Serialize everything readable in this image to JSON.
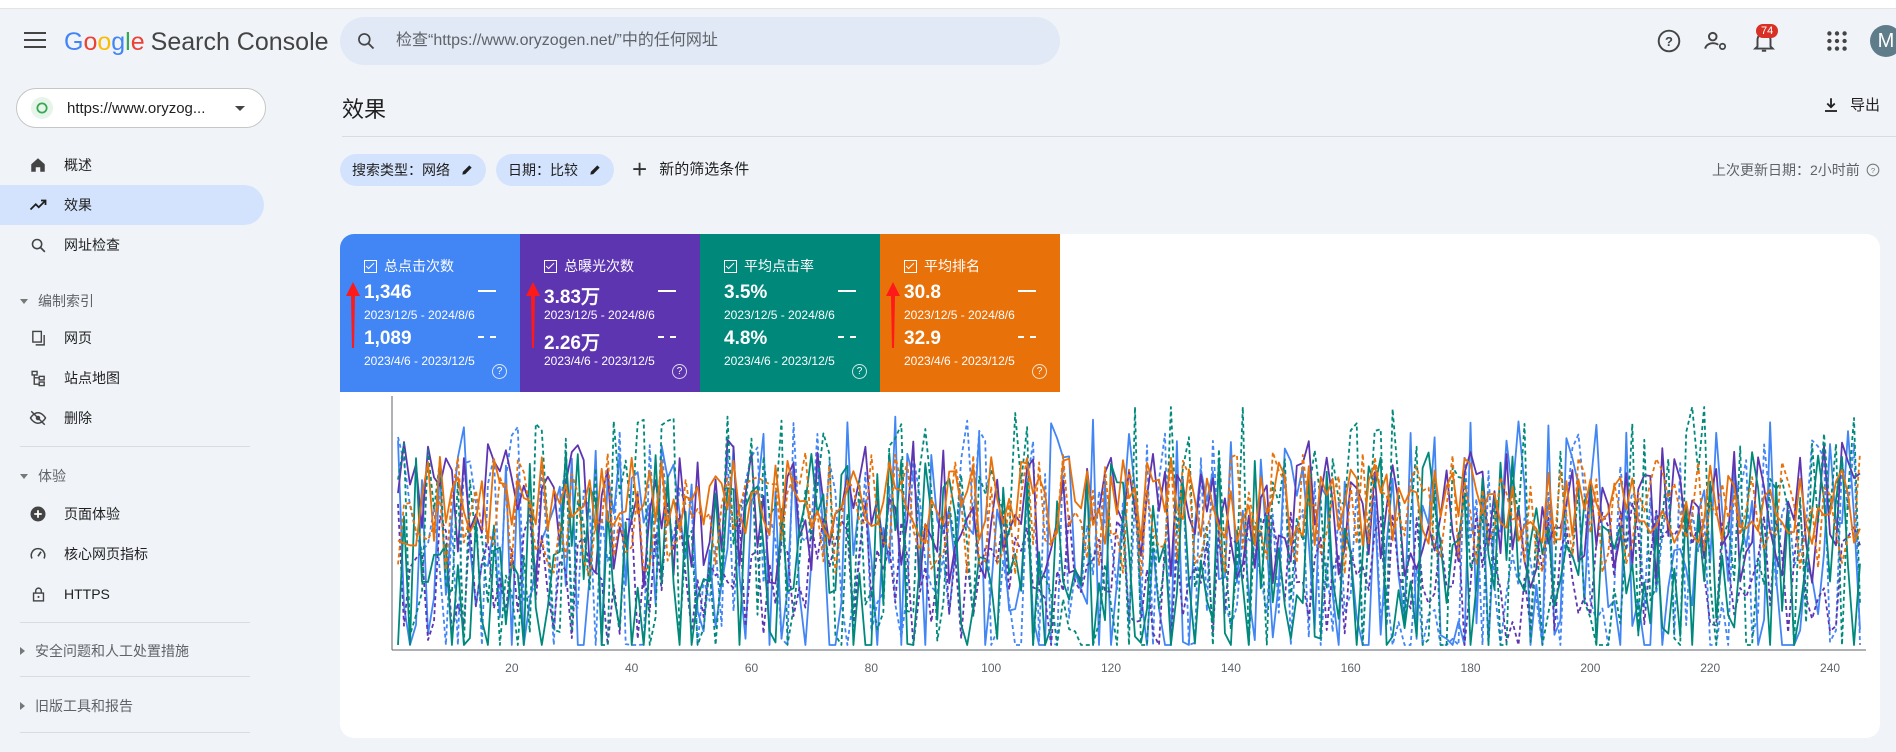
{
  "header": {
    "logo_letters": [
      "G",
      "o",
      "o",
      "g",
      "l",
      "e"
    ],
    "product": "Search Console",
    "search_placeholder": "检查“https://www.oryzogen.net/”中的任何网址",
    "notification_count": "74",
    "avatar_initial": "M"
  },
  "sidebar": {
    "property": "https://www.oryzog...",
    "items": [
      {
        "label": "概述",
        "icon": "home-icon"
      },
      {
        "label": "效果",
        "icon": "trending-up-icon",
        "active": true
      },
      {
        "label": "网址检查",
        "icon": "search-icon"
      }
    ],
    "index_section": "编制索引",
    "index_items": [
      {
        "label": "网页",
        "icon": "pages-icon"
      },
      {
        "label": "站点地图",
        "icon": "sitemap-icon"
      },
      {
        "label": "删除",
        "icon": "eye-off-icon"
      }
    ],
    "experience_section": "体验",
    "experience_items": [
      {
        "label": "页面体验",
        "icon": "plus-circle-icon"
      },
      {
        "label": "核心网页指标",
        "icon": "speed-icon"
      },
      {
        "label": "HTTPS",
        "icon": "lock-icon"
      }
    ],
    "security_section": "安全问题和人工处置措施",
    "legacy_section": "旧版工具和报告"
  },
  "main": {
    "title": "效果",
    "export_label": "导出",
    "filters": [
      "搜索类型：网络",
      "日期：比较"
    ],
    "add_filter": "新的筛选条件",
    "last_updated": "上次更新日期：2小时前"
  },
  "metrics": [
    {
      "label": "总点击次数",
      "value1": "1,346",
      "range1": "2023/12/5 - 2024/8/6",
      "value2": "1,089",
      "range2": "2023/4/6 - 2023/12/5",
      "color": "#4285f4",
      "arrow": true
    },
    {
      "label": "总曝光次数",
      "value1": "3.83万",
      "range1": "2023/12/5 - 2024/8/6",
      "value2": "2.26万",
      "range2": "2023/4/6 - 2023/12/5",
      "color": "#5e35b1",
      "arrow": true
    },
    {
      "label": "平均点击率",
      "value1": "3.5%",
      "range1": "2023/12/5 - 2024/8/6",
      "value2": "4.8%",
      "range2": "2023/4/6 - 2023/12/5",
      "color": "#00897b",
      "arrow": false
    },
    {
      "label": "平均排名",
      "value1": "30.8",
      "range1": "2023/12/5 - 2024/8/6",
      "value2": "32.9",
      "range2": "2023/4/6 - 2023/12/5",
      "color": "#e8710a",
      "arrow": true
    }
  ],
  "chart_data": {
    "type": "line",
    "x_ticks": [
      20,
      40,
      60,
      80,
      100,
      120,
      140,
      160,
      180,
      200,
      220,
      240
    ],
    "x_range": [
      1,
      245
    ],
    "y_range": [
      0,
      100
    ],
    "series": [
      {
        "metric": "总点击次数",
        "period": "current",
        "color": "#4285f4",
        "style": "solid",
        "seed": 11,
        "base": 40,
        "amp": 55
      },
      {
        "metric": "总点击次数",
        "period": "previous",
        "color": "#4285f4",
        "style": "dashed",
        "seed": 23,
        "base": 38,
        "amp": 55
      },
      {
        "metric": "总曝光次数",
        "period": "current",
        "color": "#5e35b1",
        "style": "solid",
        "seed": 37,
        "base": 55,
        "amp": 30
      },
      {
        "metric": "总曝光次数",
        "period": "previous",
        "color": "#5e35b1",
        "style": "dashed",
        "seed": 41,
        "base": 30,
        "amp": 30
      },
      {
        "metric": "平均点击率",
        "period": "current",
        "color": "#00897b",
        "style": "solid",
        "seed": 53,
        "base": 35,
        "amp": 45
      },
      {
        "metric": "平均点击率",
        "period": "previous",
        "color": "#00897b",
        "style": "dashed",
        "seed": 67,
        "base": 45,
        "amp": 55
      },
      {
        "metric": "平均排名",
        "period": "current",
        "color": "#e8710a",
        "style": "solid",
        "seed": 71,
        "base": 60,
        "amp": 18
      },
      {
        "metric": "平均排名",
        "period": "previous",
        "color": "#e8710a",
        "style": "dashed",
        "seed": 83,
        "base": 55,
        "amp": 25
      }
    ]
  }
}
